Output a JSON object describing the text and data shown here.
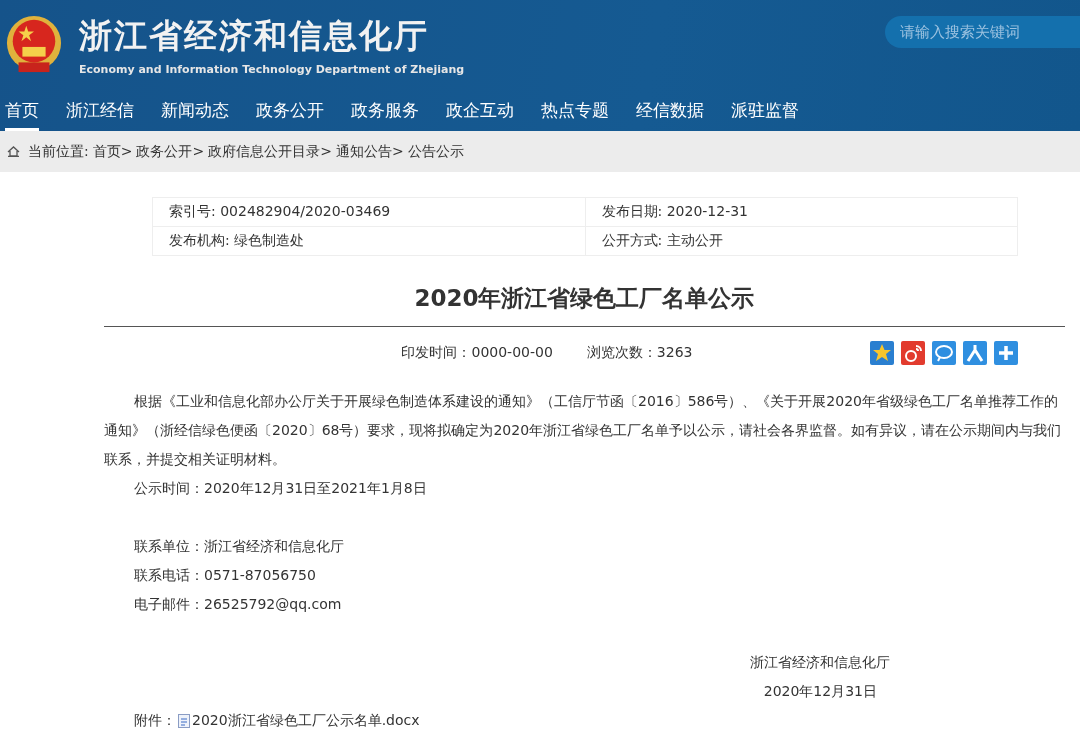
{
  "header": {
    "title": "浙江省经济和信息化厅",
    "subtitle": "Economy and Information Technology Department of Zhejiang",
    "search": {
      "placeholder": "请输入搜索关键词"
    }
  },
  "nav": [
    {
      "label": "首页",
      "selected": true
    },
    {
      "label": "浙江经信",
      "selected": false
    },
    {
      "label": "新闻动态",
      "selected": false
    },
    {
      "label": "政务公开",
      "selected": false
    },
    {
      "label": "政务服务",
      "selected": false
    },
    {
      "label": "政企互动",
      "selected": false
    },
    {
      "label": "热点专题",
      "selected": false
    },
    {
      "label": "经信数据",
      "selected": false
    },
    {
      "label": "派驻监督",
      "selected": false
    }
  ],
  "breadcrumb": {
    "prefix": "当前位置:",
    "items": [
      "首页>",
      "政务公开>",
      "政府信息公开目录>",
      "通知公告>",
      "公告公示"
    ]
  },
  "info": [
    [
      "索引号: 002482904/2020-03469",
      "发布日期: 2020-12-31"
    ],
    [
      "发布机构: 绿色制造处",
      "公开方式: 主动公开"
    ]
  ],
  "article": {
    "title": "2020年浙江省绿色工厂名单公示",
    "print_time": "印发时间：0000-00-00",
    "views": "浏览次数：3263",
    "paragraph": "根据《工业和信息化部办公厅关于开展绿色制造体系建设的通知》（工信厅节函〔2016〕586号）、《关于开展2020年省级绿色工厂名单推荐工作的通知》（浙经信绿色便函〔2020〕68号）要求，现将拟确定为2020年浙江省绿色工厂名单予以公示，请社会各界监督。如有异议，请在公示期间内与我们联系，并提交相关证明材料。",
    "period": "公示时间：2020年12月31日至2021年1月8日",
    "contacts": [
      "联系单位：浙江省经济和信息化厅",
      "联系电话：0571-87056750",
      "电子邮件：26525792@qq.com"
    ],
    "signature": [
      "浙江省经济和信息化厅",
      "2020年12月31日"
    ],
    "attachment_label": "附件：",
    "attachment": "2020浙江省绿色工厂公示名单.docx"
  }
}
